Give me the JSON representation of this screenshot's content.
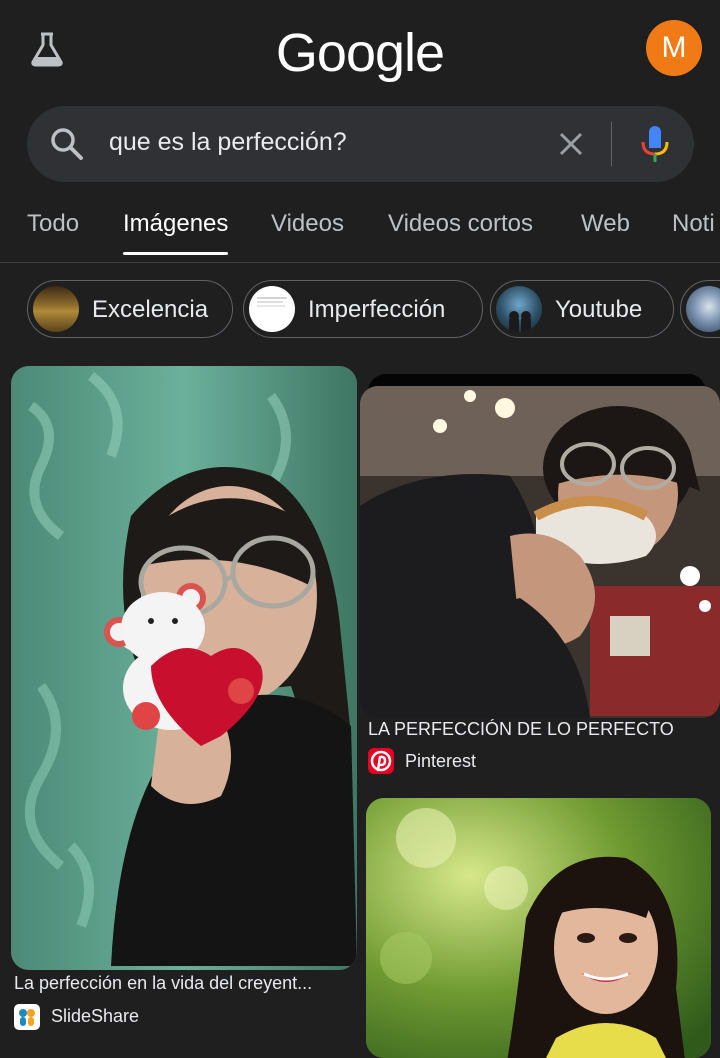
{
  "header": {
    "logo": "Google",
    "avatar_letter": "M",
    "avatar_color": "#f07b16"
  },
  "search": {
    "query": "que es la perfección?"
  },
  "tabs": [
    {
      "label": "Todo"
    },
    {
      "label": "Imágenes",
      "active": true
    },
    {
      "label": "Videos"
    },
    {
      "label": "Videos cortos"
    },
    {
      "label": "Web"
    },
    {
      "label": "Noti"
    }
  ],
  "chips": [
    {
      "label": "Excelencia"
    },
    {
      "label": "Imperfección"
    },
    {
      "label": "Youtube"
    }
  ],
  "results": [
    {
      "title": "La perfección en la vida del creyent...",
      "source": "SlideShare"
    },
    {
      "title": "LA PERFECCIÓN DE LO PERFECTO",
      "source": "Pinterest"
    }
  ]
}
